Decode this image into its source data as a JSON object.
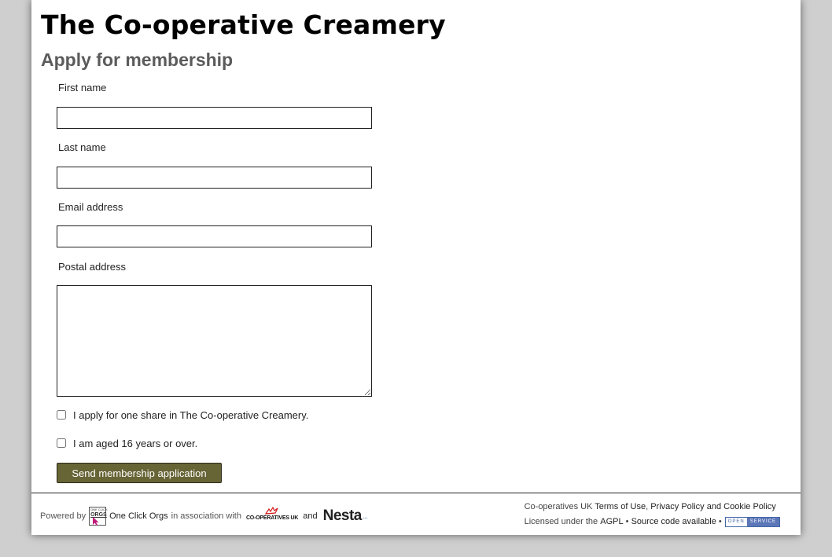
{
  "site": {
    "title": "The Co-operative Creamery"
  },
  "page": {
    "heading": "Apply for membership"
  },
  "form": {
    "first_name": {
      "label": "First name",
      "value": ""
    },
    "last_name": {
      "label": "Last name",
      "value": ""
    },
    "email": {
      "label": "Email address",
      "value": ""
    },
    "postal_address": {
      "label": "Postal address",
      "value": ""
    },
    "checkboxes": [
      {
        "label": "I apply for one share in The Co-operative Creamery.",
        "checked": false
      },
      {
        "label": "I am aged 16 years or over.",
        "checked": false
      }
    ],
    "submit_label": "Send membership application"
  },
  "footer": {
    "powered_by": "Powered by",
    "oco_logo_text_top": "ONE CLICK",
    "oco_logo_text_main": "ORGS",
    "oco_name": "One Click Orgs",
    "association": "in association with",
    "coop_logo_text": "CO-OPERATIVES UK",
    "and": "and",
    "nesta": "Nesta",
    "nesta_dots": "...",
    "line1_prefix": "Co-operatives UK",
    "terms": "Terms of Use",
    "comma": ",",
    "privacy": "Privacy Policy",
    "and2": "and",
    "cookie": "Cookie Policy",
    "license_text": "Licensed under the",
    "agpl": "AGPL",
    "bullet": "•",
    "source": "Source code available",
    "open_service_a": "OPEN",
    "open_service_b": "SERVICE"
  },
  "colors": {
    "button": "#676436",
    "heading_gray": "#5b5b5b",
    "open_service_blue": "#5c77b8",
    "background": "#cfcfcf"
  },
  "icons": [
    "one-click-orgs-logo",
    "co-operatives-uk-logo",
    "nesta-logo",
    "open-service-badge"
  ]
}
